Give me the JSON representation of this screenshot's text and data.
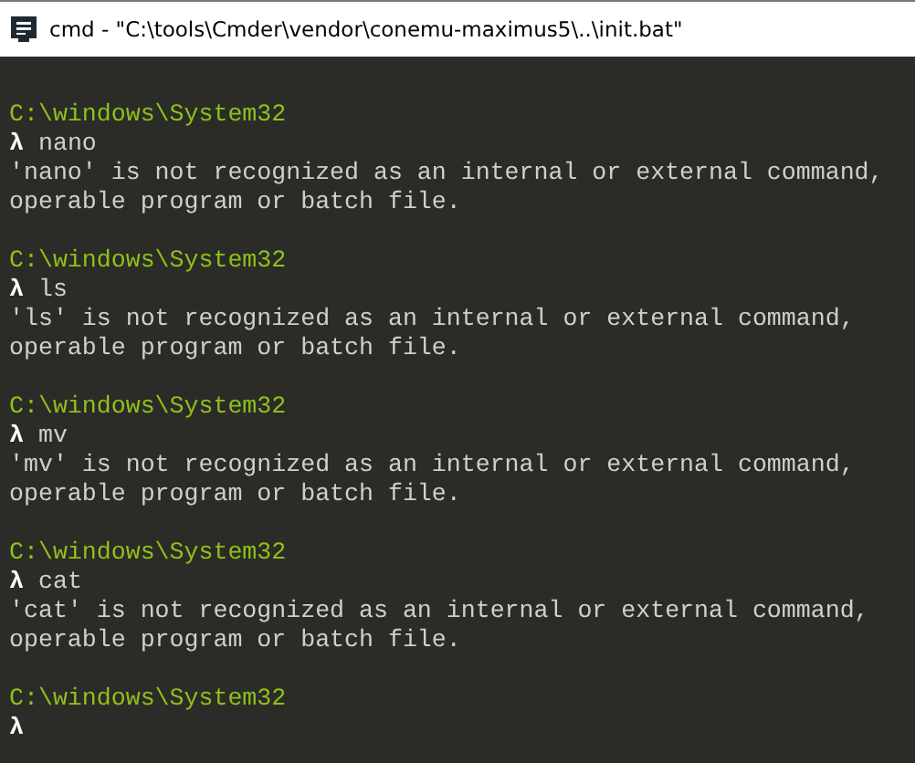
{
  "window": {
    "title": "cmd - \"C:\\tools\\Cmder\\vendor\\conemu-maximus5\\..\\init.bat\""
  },
  "blocks": [
    {
      "path": "C:\\windows\\System32",
      "prompt": "λ",
      "command": "nano",
      "output": [
        "'nano' is not recognized as an internal or external command,",
        "operable program or batch file."
      ]
    },
    {
      "path": "C:\\windows\\System32",
      "prompt": "λ",
      "command": "ls",
      "output": [
        "'ls' is not recognized as an internal or external command,",
        "operable program or batch file."
      ]
    },
    {
      "path": "C:\\windows\\System32",
      "prompt": "λ",
      "command": "mv",
      "output": [
        "'mv' is not recognized as an internal or external command,",
        "operable program or batch file."
      ]
    },
    {
      "path": "C:\\windows\\System32",
      "prompt": "λ",
      "command": "cat",
      "output": [
        "'cat' is not recognized as an internal or external command,",
        "operable program or batch file."
      ]
    },
    {
      "path": "C:\\windows\\System32",
      "prompt": "λ"
    }
  ]
}
